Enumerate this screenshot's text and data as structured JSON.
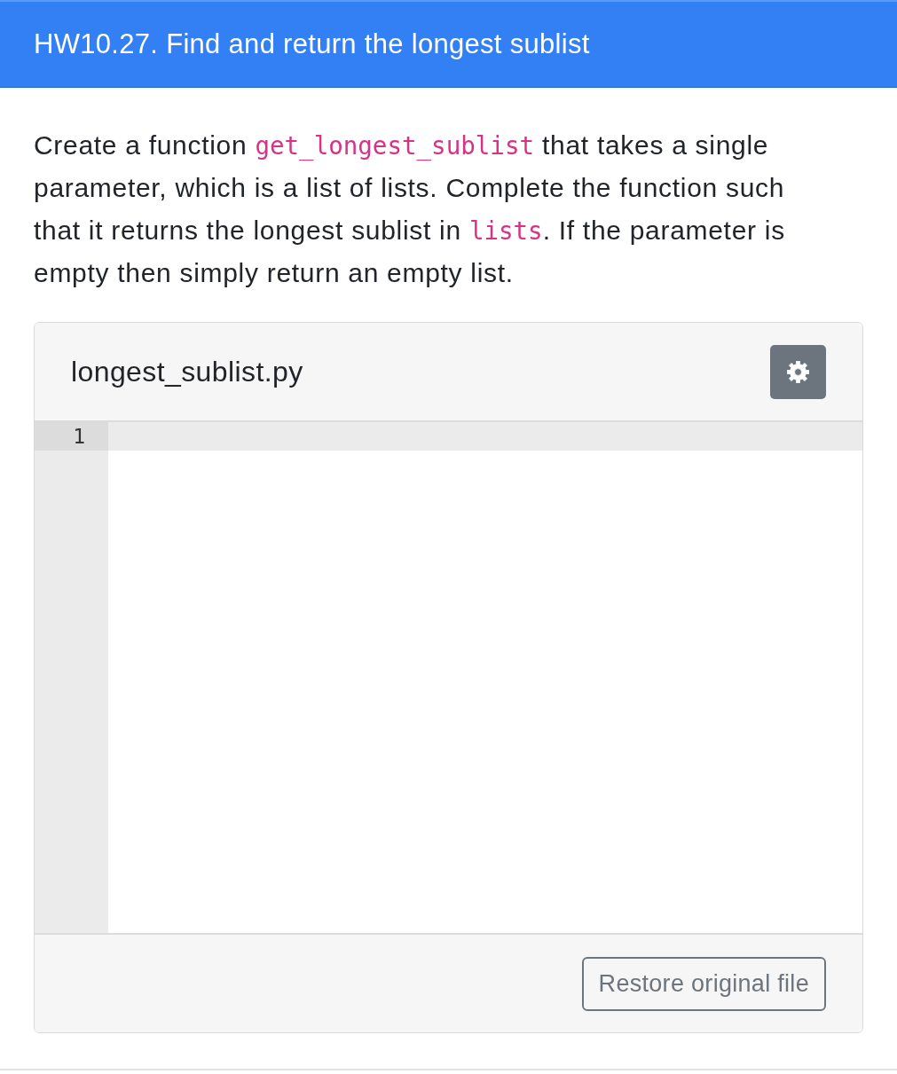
{
  "header": {
    "title": "HW10.27. Find and return the longest sublist"
  },
  "question": {
    "segments": [
      {
        "kind": "text",
        "text": "Create a function "
      },
      {
        "kind": "code",
        "text": "get_longest_sublist"
      },
      {
        "kind": "text",
        "text": " that takes a single parameter, which is a list of lists. Complete the function such that it returns the longest sublist in "
      },
      {
        "kind": "code",
        "text": "lists"
      },
      {
        "kind": "text",
        "text": ". If the parameter is empty then simply return an empty list."
      }
    ]
  },
  "editor": {
    "filename": "longest_sublist.py",
    "lines": [
      {
        "number": "1",
        "active": true
      }
    ],
    "footer_button": "Restore original file"
  }
}
